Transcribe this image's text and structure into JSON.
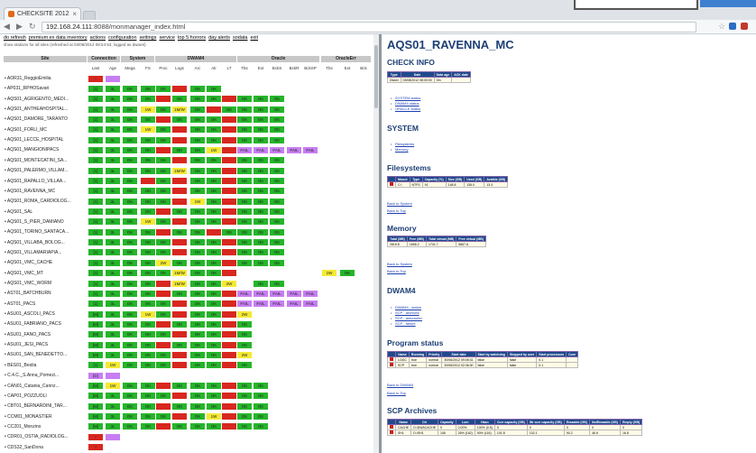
{
  "browser": {
    "tab_title": "CHECKSITE 2012",
    "url_host": "192.168.24.111",
    "url_path": ":8088/monmanager_index.html",
    "back_icon": "back-arrow-icon",
    "forward_icon": "forward-arrow-icon",
    "reload_icon": "reload-icon",
    "star_icon": "star-icon"
  },
  "left": {
    "menu": [
      "do refresh",
      "premium ex data inventory",
      "actions",
      "configuration",
      "settings",
      "service",
      "top 5 horrors",
      "day alerts",
      "sodata",
      "exit"
    ],
    "note": "show stations for all sites (refreshed at 03/08/2012 08:54:53, logged as dwaret)",
    "groups": [
      {
        "key": "site",
        "label": "Site"
      },
      {
        "key": "conn",
        "label": "Connection"
      },
      {
        "key": "sys",
        "label": "System"
      },
      {
        "key": "dwam",
        "label": "DWAM4"
      },
      {
        "key": "oracle",
        "label": "Oracle"
      },
      {
        "key": "oraerr",
        "label": "OracleErr"
      }
    ],
    "columns": [
      "Last",
      "Age",
      "Mega",
      "FS",
      "Proc",
      "Logs",
      "Arc",
      "Alr",
      "LT",
      "Tbs",
      "Ext",
      "BckS",
      "BckR",
      "BckSP",
      "Tbs",
      "Ext",
      "Bck"
    ],
    "rows": [
      {
        "name": "AOR31_ReggioEmilia",
        "cells": [
          "R|!|",
          "V|"
        ]
      },
      {
        "name": "AP031_RPHOSavari",
        "cells": [
          "G|[1]",
          "G|3L",
          "G|OK",
          "G|OK",
          "G|OK",
          "R|",
          "G|OK",
          "G|OK"
        ]
      },
      {
        "name": "AQS01_AGRIGENTO_MEDI...",
        "cells": [
          "G|[1]",
          "G|3L",
          "G|OK",
          "G|OK",
          "R|",
          "G|OK",
          "G|OK",
          "G|OK",
          "R|",
          "G|OK",
          "G|OK",
          "G|OK"
        ]
      },
      {
        "name": "AQS01_ANTHEAHOSPITAL...",
        "cells": [
          "G|[1]",
          "G|3L",
          "G|OK",
          "Y|1W",
          "G|OK",
          "Y|1M/W",
          "G|OK",
          "R|",
          "G|OK",
          "G|OK",
          "G|OK",
          "G|OK"
        ]
      },
      {
        "name": "AQS01_DAMORE_TARANTO",
        "cells": [
          "G|[1]",
          "G|3L",
          "G|OK",
          "G|OK",
          "R|",
          "G|OK",
          "G|OK",
          "G|OK",
          "R|",
          "G|OK",
          "G|OK",
          "G|OK"
        ]
      },
      {
        "name": "AQS01_FORLI_MC",
        "cells": [
          "G|[1]",
          "G|3L",
          "G|OK",
          "Y|1W",
          "G|OK",
          "R|",
          "G|OK",
          "G|OK",
          "R|",
          "G|OK",
          "G|OK",
          "G|OK"
        ]
      },
      {
        "name": "AQS01_LECCE_HOSPITAL",
        "cells": [
          "G|[1]",
          "G|3L",
          "G|OK",
          "G|OK",
          "G|OK",
          "R|",
          "G|OK",
          "G|OK",
          "R|",
          "G|OK",
          "G|OK",
          "G|OK"
        ]
      },
      {
        "name": "AQS01_MANGIONIPACS",
        "cells": [
          "G|[1]",
          "G|3L",
          "G|OK",
          "G|OK",
          "R|",
          "G|OK",
          "G|OK",
          "Y|1W",
          "R|",
          "P|FAIL",
          "P|FAIL",
          "P|FAIL",
          "P|FAIL",
          "P|FAIL"
        ]
      },
      {
        "name": "AQS01_MONTECATINI_SA...",
        "cells": [
          "G|[1]",
          "G|3L",
          "G|OK",
          "G|OK",
          "G|OK",
          "R|",
          "G|OK",
          "G|OK",
          "R|",
          "G|OK",
          "G|OK",
          "G|OK"
        ]
      },
      {
        "name": "AQS01_PALERMO_VILLAM...",
        "cells": [
          "G|[1]",
          "G|3L",
          "G|OK",
          "G|OK",
          "G|OK",
          "Y|1M/W",
          "G|OK",
          "G|OK",
          "R|",
          "G|OK",
          "G|OK",
          "G|OK"
        ]
      },
      {
        "name": "AQS01_RAPALLO_VILLAA...",
        "cells": [
          "G|[1]",
          "G|3L",
          "G|OK",
          "R|",
          "G|OK",
          "R|",
          "G|OK",
          "G|OK",
          "R|",
          "G|OK",
          "G|OK",
          "G|OK"
        ]
      },
      {
        "name": "AQS01_RAVENNA_MC",
        "cells": [
          "G|[1]",
          "G|3L",
          "G|OK",
          "G|OK",
          "G|OK",
          "R|",
          "G|OK",
          "G|OK",
          "R|",
          "G|OK",
          "G|OK",
          "G|OK"
        ]
      },
      {
        "name": "AQS01_ROMA_CARDIOLOG...",
        "cells": [
          "G|[1]",
          "G|3L",
          "G|OK",
          "G|OK",
          "G|OK",
          "R|",
          "Y|1W",
          "G|OK",
          "R|",
          "G|OK",
          "G|OK",
          "G|OK"
        ]
      },
      {
        "name": "AQS01_SAL",
        "cells": [
          "G|[1]",
          "G|3L",
          "G|OK",
          "G|OK",
          "R|",
          "G|OK",
          "G|OK",
          "G|OK",
          "R|",
          "G|OK",
          "G|OK",
          "G|OK"
        ]
      },
      {
        "name": "AQS01_S_PIER_DAMIANO",
        "cells": [
          "G|[1]",
          "G|3L",
          "G|OK",
          "Y|1W",
          "G|OK",
          "R|",
          "G|OK",
          "G|OK",
          "R|",
          "G|OK",
          "G|OK",
          "G|OK"
        ]
      },
      {
        "name": "AQS01_TORINO_SANTACA...",
        "cells": [
          "G|[1]",
          "G|3L",
          "G|OK",
          "G|OK",
          "R|",
          "G|OK",
          "G|OK",
          "R|",
          "G|OK",
          "G|OK",
          "G|OK",
          "G|OK"
        ]
      },
      {
        "name": "AQS01_VILLABA_BOLOG...",
        "cells": [
          "G|[1]",
          "G|3L",
          "G|OK",
          "G|OK",
          "G|OK",
          "R|",
          "G|OK",
          "G|OK",
          "R|",
          "G|OK",
          "G|OK",
          "G|OK"
        ]
      },
      {
        "name": "AQS01_VILLAMARIAPIA...",
        "cells": [
          "G|[1]",
          "G|3L",
          "G|OK",
          "G|OK",
          "G|OK",
          "R|",
          "G|OK",
          "G|OK",
          "R|",
          "G|OK",
          "G|OK",
          "G|OK"
        ]
      },
      {
        "name": "AQS01_VMC_CACHE",
        "cells": [
          "G|[1]",
          "G|3L",
          "G|OK",
          "G|OK",
          "Y|2W",
          "G|OK",
          "G|OK",
          "G|OK",
          "R|",
          "G|OK",
          "G|OK",
          "G|OK"
        ]
      },
      {
        "name": "AQS01_VMC_MT",
        "cells": [
          "G|[1]",
          "G|3L",
          "G|OK",
          "G|OK",
          "G|OK",
          "Y|1M/W",
          "G|OK",
          "G|OK",
          "R|",
          "",
          "",
          "",
          "",
          "",
          "Y|1W",
          "G|OK"
        ]
      },
      {
        "name": "AQS01_VMC_WORM",
        "cells": [
          "G|[1]",
          "G|3L",
          "G|OK",
          "G|OK",
          "R|",
          "Y|1M/W",
          "G|OK",
          "G|OK",
          "Y|2W",
          "",
          "G|OK",
          "G|OK"
        ]
      },
      {
        "name": "AST01_BATCHBURN",
        "cells": [
          "G|[1]",
          "G|3L",
          "G|OK",
          "G|OK",
          "R|",
          "G|OK",
          "G|OK",
          "G|OK",
          "R|",
          "P|FAIL",
          "P|FAIL",
          "P|FAIL",
          "P|FAIL",
          "P|FAIL"
        ]
      },
      {
        "name": "AST01_PACS",
        "cells": [
          "G|[1]",
          "G|3L",
          "G|OK",
          "G|OK",
          "G|OK",
          "R|",
          "G|OK",
          "G|OK",
          "R|",
          "P|FAIL",
          "P|FAIL",
          "P|FAIL",
          "P|FAIL",
          "P|FAIL"
        ]
      },
      {
        "name": "ASU01_ASCOLI_PACS",
        "cells": [
          "G|[M]",
          "G|3L",
          "G|OK",
          "Y|1W",
          "G|OK",
          "R|",
          "G|OK",
          "G|OK",
          "R|",
          "Y|2W"
        ]
      },
      {
        "name": "ASU01_FABRIANO_PACS",
        "cells": [
          "G|[M]",
          "G|3L",
          "G|OK",
          "G|OK",
          "R|",
          "G|OK",
          "G|OK",
          "G|OK",
          "R|",
          "G|OK"
        ]
      },
      {
        "name": "ASU01_FANO_PACS",
        "cells": [
          "G|[M]",
          "G|3L",
          "G|OK",
          "G|OK",
          "G|OK",
          "R|",
          "G|OK",
          "G|OK",
          "R|",
          "G|OK"
        ]
      },
      {
        "name": "ASU01_JESI_PACS",
        "cells": [
          "G|[M]",
          "G|3L",
          "G|OK",
          "G|OK",
          "R|",
          "G|OK",
          "G|OK",
          "G|OK",
          "R|",
          "G|OK"
        ]
      },
      {
        "name": "ASU01_SAN_BENEDETTO...",
        "cells": [
          "G|[M]",
          "G|3L",
          "G|OK",
          "G|OK",
          "G|OK",
          "R|",
          "G|OK",
          "G|OK",
          "R|",
          "Y|2W"
        ]
      },
      {
        "name": "BES01_Bestia",
        "cells": [
          "G|[1]",
          "Y|1W",
          "G|OK",
          "G|OK",
          "G|OK",
          "R|",
          "G|OK",
          "G|OK",
          "R|",
          "G|OK"
        ]
      },
      {
        "name": "C.4.C._S.Anna_Pomezi...",
        "cells": [
          "V|[D]",
          "V|"
        ]
      },
      {
        "name": "CAN01_Catania_Cannz...",
        "cells": [
          "G|[M]",
          "Y|1W",
          "G|OK",
          "G|OK",
          "R|",
          "G|OK",
          "G|OK",
          "G|OK",
          "R|",
          "G|OK",
          "G|OK"
        ]
      },
      {
        "name": "CAP01_POZZUOLI",
        "cells": [
          "G|[M]",
          "G|3L",
          "G|OK",
          "G|OK",
          "G|OK",
          "R|",
          "G|OK",
          "G|OK",
          "R|",
          "G|OK",
          "G|OK"
        ]
      },
      {
        "name": "CBT01_BERNARDINI_TAR...",
        "cells": [
          "G|[M]",
          "G|3L",
          "G|OK",
          "G|OK",
          "R|",
          "G|OK",
          "G|OK",
          "G|OK",
          "R|",
          "G|OK",
          "G|OK"
        ]
      },
      {
        "name": "CCM01_MONASTIER",
        "cells": [
          "G|[M]",
          "G|3L",
          "G|OK",
          "G|OK",
          "G|OK",
          "R|",
          "G|OK",
          "Y|1W",
          "R|",
          "G|OK",
          "G|OK"
        ]
      },
      {
        "name": "CC201_Monzino",
        "cells": [
          "G|[M]",
          "G|3L",
          "G|OK",
          "G|OK",
          "R|",
          "G|OK",
          "G|OK",
          "G|OK",
          "R|",
          "G|OK",
          "G|OK"
        ]
      },
      {
        "name": "CDR01_OSTIA_RADIOLOG...",
        "cells": [
          "R|!|",
          "V|"
        ]
      },
      {
        "name": "CDS32_SanDona",
        "cells": [
          "R|!|"
        ]
      }
    ]
  },
  "right": {
    "title": "AQS01_RAVENNA_MC",
    "check_info": {
      "heading": "CHECK INFO",
      "headers": [
        "Type",
        "Date",
        "Data age",
        "ACK date"
      ],
      "row": [
        "Dwsin",
        "03/08/2012 08:00:00",
        "0m",
        ""
      ]
    },
    "top_links": [
      "SYSTEM status",
      "DWAM4 status",
      "ORACLE status"
    ],
    "system": {
      "heading": "SYSTEM",
      "links": [
        "Filesystems",
        "Memory"
      ]
    },
    "filesystems": {
      "heading": "Filesystems",
      "headers": [
        "",
        "Mount",
        "Type",
        "Capacity (%)",
        "Size (GB)",
        "Used (GB)",
        "Avaible (GB)"
      ],
      "rows": [
        [
          "",
          "C:\\",
          "NTFS",
          "91",
          "148.8",
          "135.0",
          "13.4"
        ]
      ],
      "back_links": [
        "Back to System",
        "Back to Top"
      ]
    },
    "memory": {
      "heading": "Memory",
      "headers": [
        "Total (MB)",
        "Free (MB)",
        "Total virtual (MB)",
        "Free virtual (MB)"
      ],
      "row": [
        "2815.8",
        "1656.2",
        "1741.7",
        "5667.6"
      ],
      "back_links": [
        "Back to System",
        "Back to Top"
      ]
    },
    "dwam4": {
      "heading": "DWAM4",
      "links": [
        "DWAM4 - status",
        "SCP - archives",
        "SCP - autorouter",
        "SCP - failure"
      ]
    },
    "program_status": {
      "heading": "Program status",
      "headers": [
        "",
        "Name",
        "Running",
        "Priority",
        "Start date",
        "Start by watchdog",
        "Stopped by user",
        "Start processors",
        "Core"
      ],
      "rows": [
        [
          "",
          "LOGC",
          "true",
          "normal",
          "30/06/2012 09:05:31",
          "false",
          "false",
          "0.1",
          ""
        ],
        [
          "",
          "SCP",
          "true",
          "normal",
          "30/06/2012 02:36:30",
          "false",
          "false",
          "0.1",
          ""
        ]
      ],
      "back_links": [
        "Back to DWAM4",
        "Back to Top"
      ]
    },
    "scp_archives": {
      "heading": "SCP Archives",
      "headers": [
        "",
        "Name",
        "Dir",
        "Capacity",
        "Lsrn",
        "Hasn",
        "Curr capacity (GB)",
        "Iftr curr capacity (GB)",
        "Erasable (GB)",
        "NotErasable (GB)",
        "Empty (GB)"
      ],
      "rows": [
        [
          "",
          "CACHE",
          "D:\\DWACACHE",
          "0",
          "0.00%",
          "100% (0.5)",
          "0",
          "0",
          "0",
          "0",
          "0"
        ],
        [
          "",
          "SH1",
          "D:\\SH1",
          "106",
          "26% (162)",
          "90% (116)",
          "101.8",
          "102.1",
          "90.2",
          "46.6",
          "16.8"
        ]
      ]
    }
  },
  "colors": {
    "green": "#25b52a",
    "red": "#d8271f",
    "yellow": "#f3ea33",
    "purple": "#c77ef2",
    "title_blue": "#1d3f75"
  }
}
